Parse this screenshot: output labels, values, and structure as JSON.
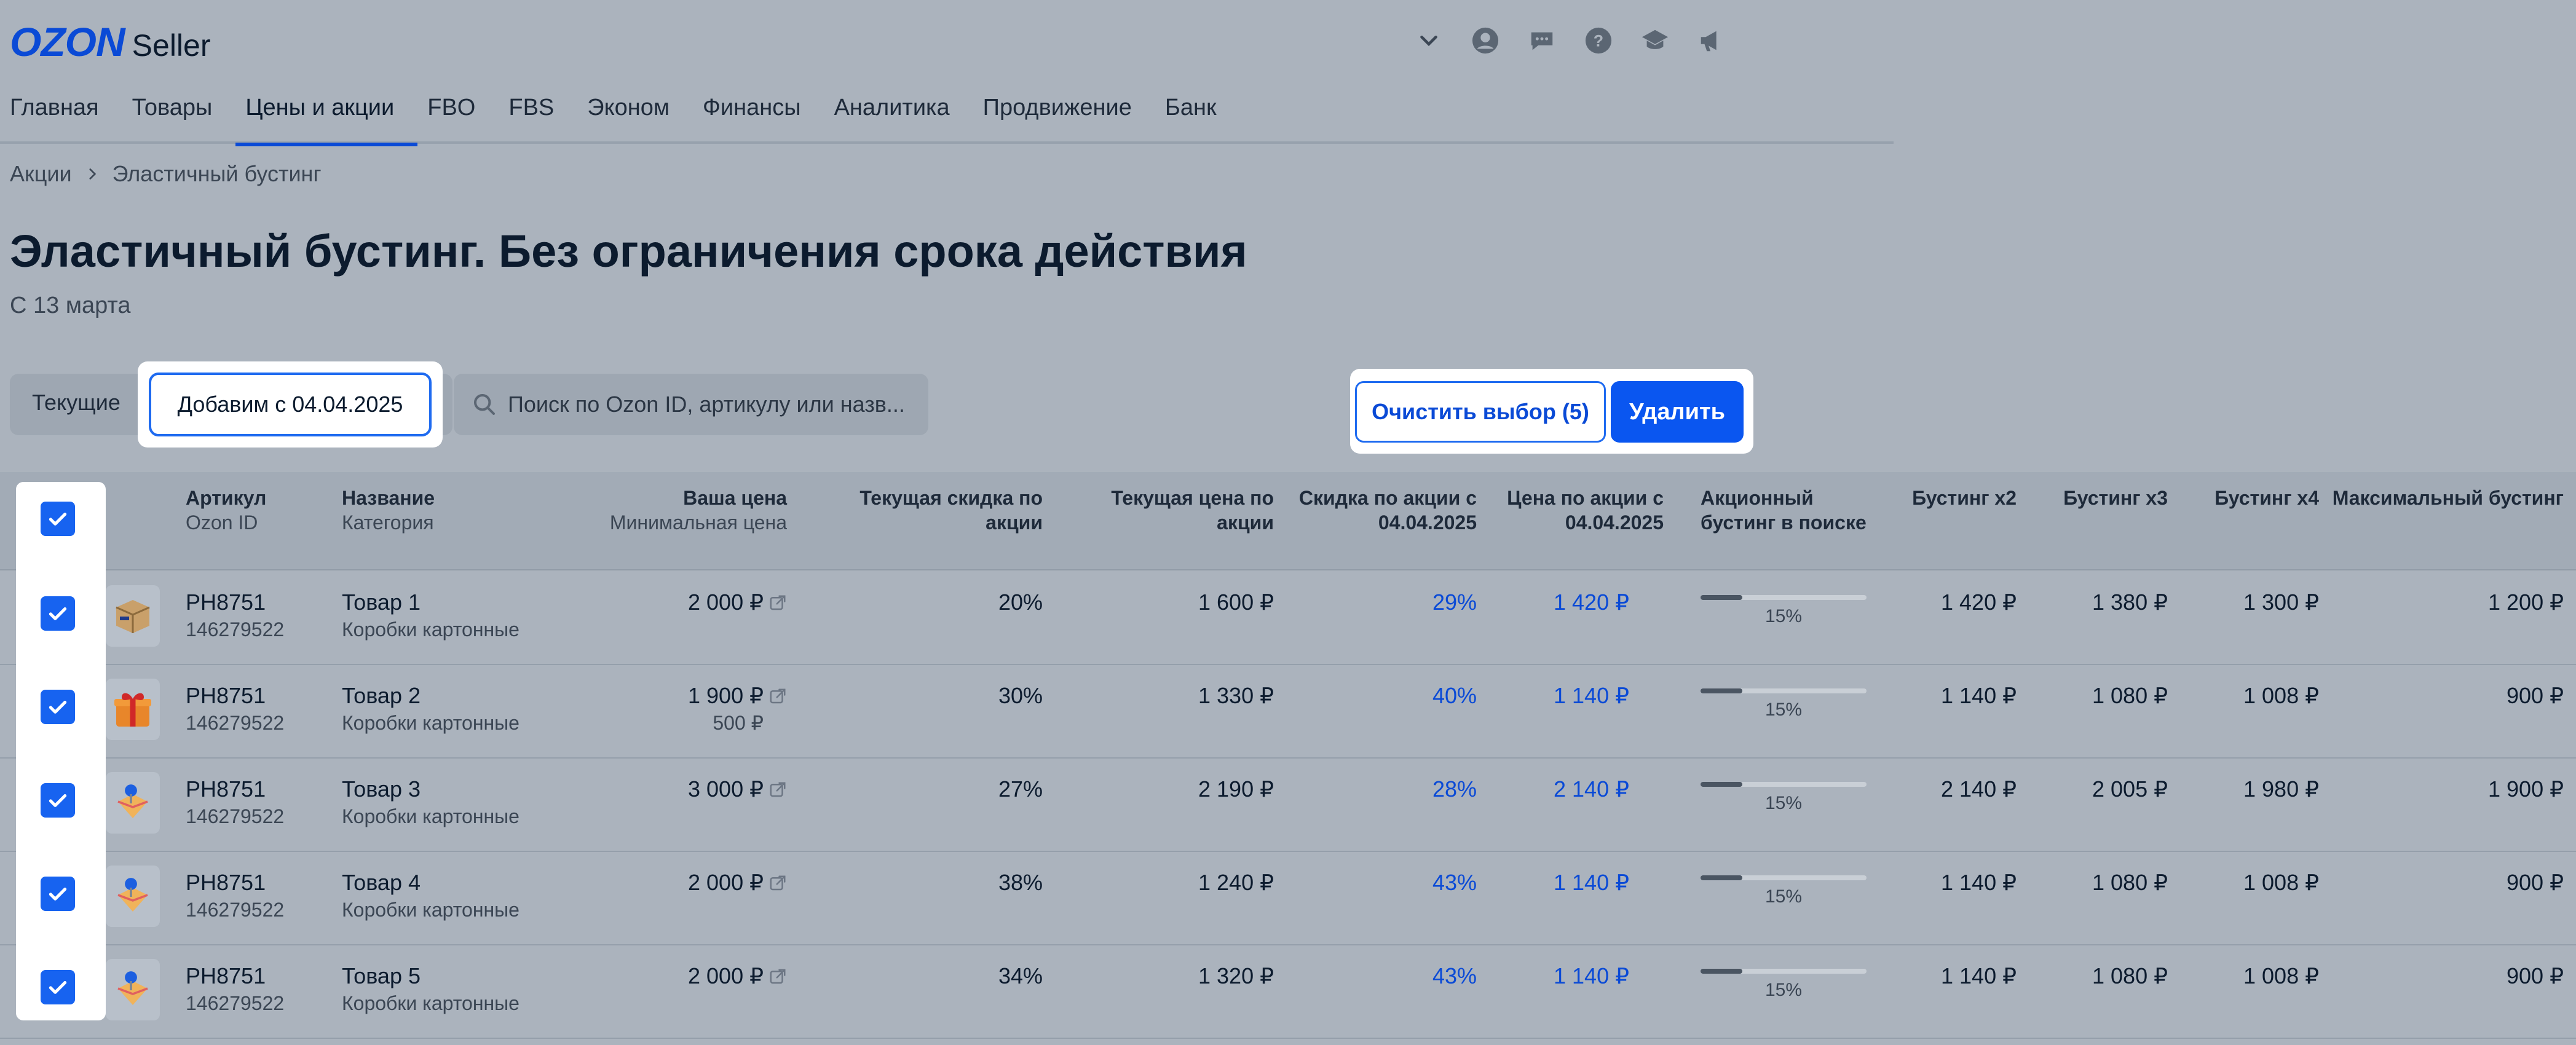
{
  "brand": {
    "logo_text": "OZON",
    "product": "Seller"
  },
  "header_icons": [
    "chevron-down-icon",
    "profile-icon",
    "chat-icon",
    "help-icon",
    "education-icon",
    "megaphone-icon"
  ],
  "nav": {
    "items": [
      {
        "label": "Главная",
        "active": false
      },
      {
        "label": "Товары",
        "active": false
      },
      {
        "label": "Цены и акции",
        "active": true
      },
      {
        "label": "FBO",
        "active": false
      },
      {
        "label": "FBS",
        "active": false
      },
      {
        "label": "Эконом",
        "active": false
      },
      {
        "label": "Финансы",
        "active": false
      },
      {
        "label": "Аналитика",
        "active": false
      },
      {
        "label": "Продвижение",
        "active": false
      },
      {
        "label": "Банк",
        "active": false
      }
    ]
  },
  "breadcrumb": {
    "parent": "Акции",
    "current": "Эластичный бустинг"
  },
  "page": {
    "title": "Эластичный бустинг. Без ограничения срока действия",
    "subtitle": "С 13 марта"
  },
  "filters": {
    "tab_current": "Текущие",
    "tab_added": "Добавим с 04.04.2025",
    "search_placeholder": "Поиск по Ozon ID, артикулу или назв..."
  },
  "actions": {
    "clear_label": "Очистить выбор (5)",
    "delete_label": "Удалить"
  },
  "table": {
    "headers": {
      "article": "Артикул",
      "article_sub": "Ozon ID",
      "name": "Название",
      "name_sub": "Категория",
      "your_price": "Ваша цена",
      "your_price_sub": "Минимальная цена",
      "cur_discount_1": "Текущая скидка по",
      "cur_discount_2": "акции",
      "cur_price_1": "Текущая цена по",
      "cur_price_2": "акции",
      "promo_discount_1": "Скидка по акции с",
      "promo_discount_2": "04.04.2025",
      "promo_price_1": "Цена по акции с",
      "promo_price_2": "04.04.2025",
      "search_boost_1": "Акционный",
      "search_boost_2": "бустинг в поиске",
      "boost_x2": "Бустинг x2",
      "boost_x3": "Бустинг x3",
      "boost_x4": "Бустинг x4",
      "boost_max": "Максимальный бустинг"
    },
    "rows": [
      {
        "article": "PH8751",
        "ozon_id": "146279522",
        "name": "Товар 1",
        "category": "Коробки картонные",
        "your_price": "2 000 ₽",
        "min_price": "",
        "cur_discount": "20%",
        "cur_price": "1 600 ₽",
        "promo_discount": "29%",
        "promo_price": "1 420 ₽",
        "search_boost": "15%",
        "search_boost_value": 0.25,
        "boost_x2": "1 420 ₽",
        "boost_x3": "1 380 ₽",
        "boost_x4": "1 300 ₽",
        "boost_max": "1 200 ₽",
        "thumb_icon": "box-icon"
      },
      {
        "article": "PH8751",
        "ozon_id": "146279522",
        "name": "Товар 2",
        "category": "Коробки картонные",
        "your_price": "1 900 ₽",
        "min_price": "500 ₽",
        "cur_discount": "30%",
        "cur_price": "1 330 ₽",
        "promo_discount": "40%",
        "promo_price": "1 140 ₽",
        "search_boost": "15%",
        "search_boost_value": 0.25,
        "boost_x2": "1 140 ₽",
        "boost_x3": "1 080 ₽",
        "boost_x4": "1 008 ₽",
        "boost_max": "900 ₽",
        "thumb_icon": "gift-icon"
      },
      {
        "article": "PH8751",
        "ozon_id": "146279522",
        "name": "Товар 3",
        "category": "Коробки картонные",
        "your_price": "3 000 ₽",
        "min_price": "",
        "cur_discount": "27%",
        "cur_price": "2 190 ₽",
        "promo_discount": "28%",
        "promo_price": "2 140 ₽",
        "search_boost": "15%",
        "search_boost_value": 0.25,
        "boost_x2": "2 140 ₽",
        "boost_x3": "2 005 ₽",
        "boost_x4": "1 980 ₽",
        "boost_max": "1 900 ₽",
        "thumb_icon": "pin-box-icon"
      },
      {
        "article": "PH8751",
        "ozon_id": "146279522",
        "name": "Товар 4",
        "category": "Коробки картонные",
        "your_price": "2 000 ₽",
        "min_price": "",
        "cur_discount": "38%",
        "cur_price": "1 240 ₽",
        "promo_discount": "43%",
        "promo_price": "1 140 ₽",
        "search_boost": "15%",
        "search_boost_value": 0.25,
        "boost_x2": "1 140 ₽",
        "boost_x3": "1 080 ₽",
        "boost_x4": "1 008 ₽",
        "boost_max": "900 ₽",
        "thumb_icon": "pin-box-icon"
      },
      {
        "article": "PH8751",
        "ozon_id": "146279522",
        "name": "Товар 5",
        "category": "Коробки картонные",
        "your_price": "2 000 ₽",
        "min_price": "",
        "cur_discount": "34%",
        "cur_price": "1 320 ₽",
        "promo_discount": "43%",
        "promo_price": "1 140 ₽",
        "search_boost": "15%",
        "search_boost_value": 0.25,
        "boost_x2": "1 140 ₽",
        "boost_x3": "1 080 ₽",
        "boost_x4": "1 008 ₽",
        "boost_max": "900 ₽",
        "thumb_icon": "pin-box-icon"
      }
    ]
  },
  "colors": {
    "accent": "#0a56f0",
    "brand": "#0a4ad6",
    "overlay": "#abb3bd"
  }
}
